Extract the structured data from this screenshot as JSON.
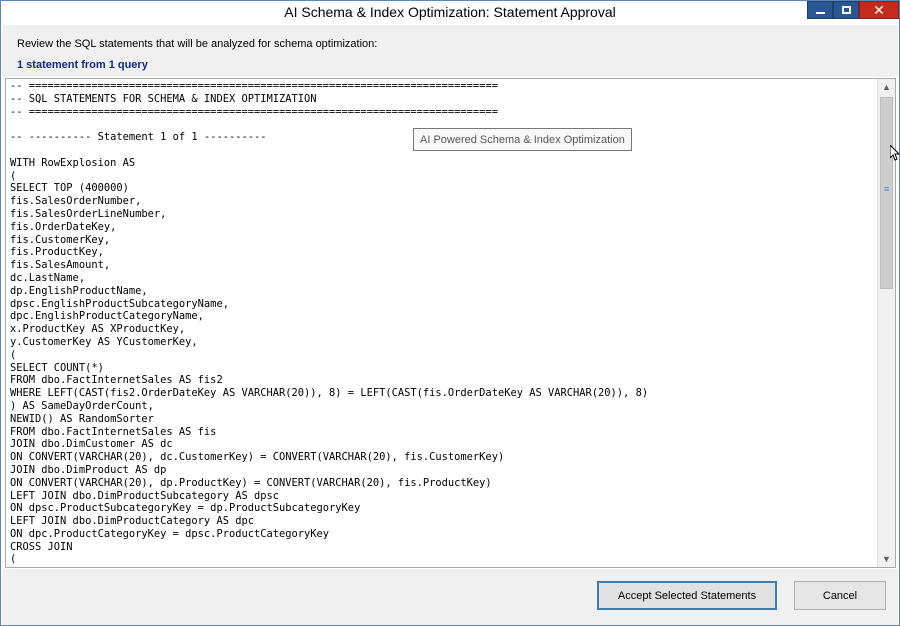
{
  "window": {
    "title": "AI Schema & Index Optimization: Statement Approval"
  },
  "header": {
    "instruction": "Review the SQL statements that will be analyzed for schema optimization:",
    "count": "1 statement from 1 query"
  },
  "tooltip": {
    "text": "AI Powered Schema & Index Optimization"
  },
  "editor": {
    "lines": [
      "-- ===========================================================================",
      "-- SQL STATEMENTS FOR SCHEMA & INDEX OPTIMIZATION",
      "-- ===========================================================================",
      "",
      "-- ---------- Statement 1 of 1 ----------",
      "",
      "WITH RowExplosion AS",
      "(",
      "SELECT TOP (400000)",
      "fis.SalesOrderNumber,",
      "fis.SalesOrderLineNumber,",
      "fis.OrderDateKey,",
      "fis.CustomerKey,",
      "fis.ProductKey,",
      "fis.SalesAmount,",
      "dc.LastName,",
      "dp.EnglishProductName,",
      "dpsc.EnglishProductSubcategoryName,",
      "dpc.EnglishProductCategoryName,",
      "x.ProductKey AS XProductKey,",
      "y.CustomerKey AS YCustomerKey,",
      "(",
      "SELECT COUNT(*)",
      "FROM dbo.FactInternetSales AS fis2",
      "WHERE LEFT(CAST(fis2.OrderDateKey AS VARCHAR(20)), 8) = LEFT(CAST(fis.OrderDateKey AS VARCHAR(20)), 8)",
      ") AS SameDayOrderCount,",
      "NEWID() AS RandomSorter",
      "FROM dbo.FactInternetSales AS fis",
      "JOIN dbo.DimCustomer AS dc",
      "ON CONVERT(VARCHAR(20), dc.CustomerKey) = CONVERT(VARCHAR(20), fis.CustomerKey)",
      "JOIN dbo.DimProduct AS dp",
      "ON CONVERT(VARCHAR(20), dp.ProductKey) = CONVERT(VARCHAR(20), fis.ProductKey)",
      "LEFT JOIN dbo.DimProductSubcategory AS dpsc",
      "ON dpsc.ProductSubcategoryKey = dp.ProductSubcategoryKey",
      "LEFT JOIN dbo.DimProductCategory AS dpc",
      "ON dpc.ProductCategoryKey = dpsc.ProductCategoryKey",
      "CROSS JOIN",
      "("
    ]
  },
  "footer": {
    "accept_label": "Accept Selected Statements",
    "cancel_label": "Cancel"
  },
  "icons": {
    "minimize": "minimize-icon",
    "maximize": "maximize-icon",
    "close": "close-icon",
    "scroll_up": "chevron-up-icon",
    "scroll_down": "chevron-down-icon"
  },
  "colors": {
    "window_border": "#5a87b8",
    "control_blue": "#2b5694",
    "close_red": "#c42b1c",
    "count_text": "#0f2a8c",
    "accept_border": "#3c7fb1"
  }
}
